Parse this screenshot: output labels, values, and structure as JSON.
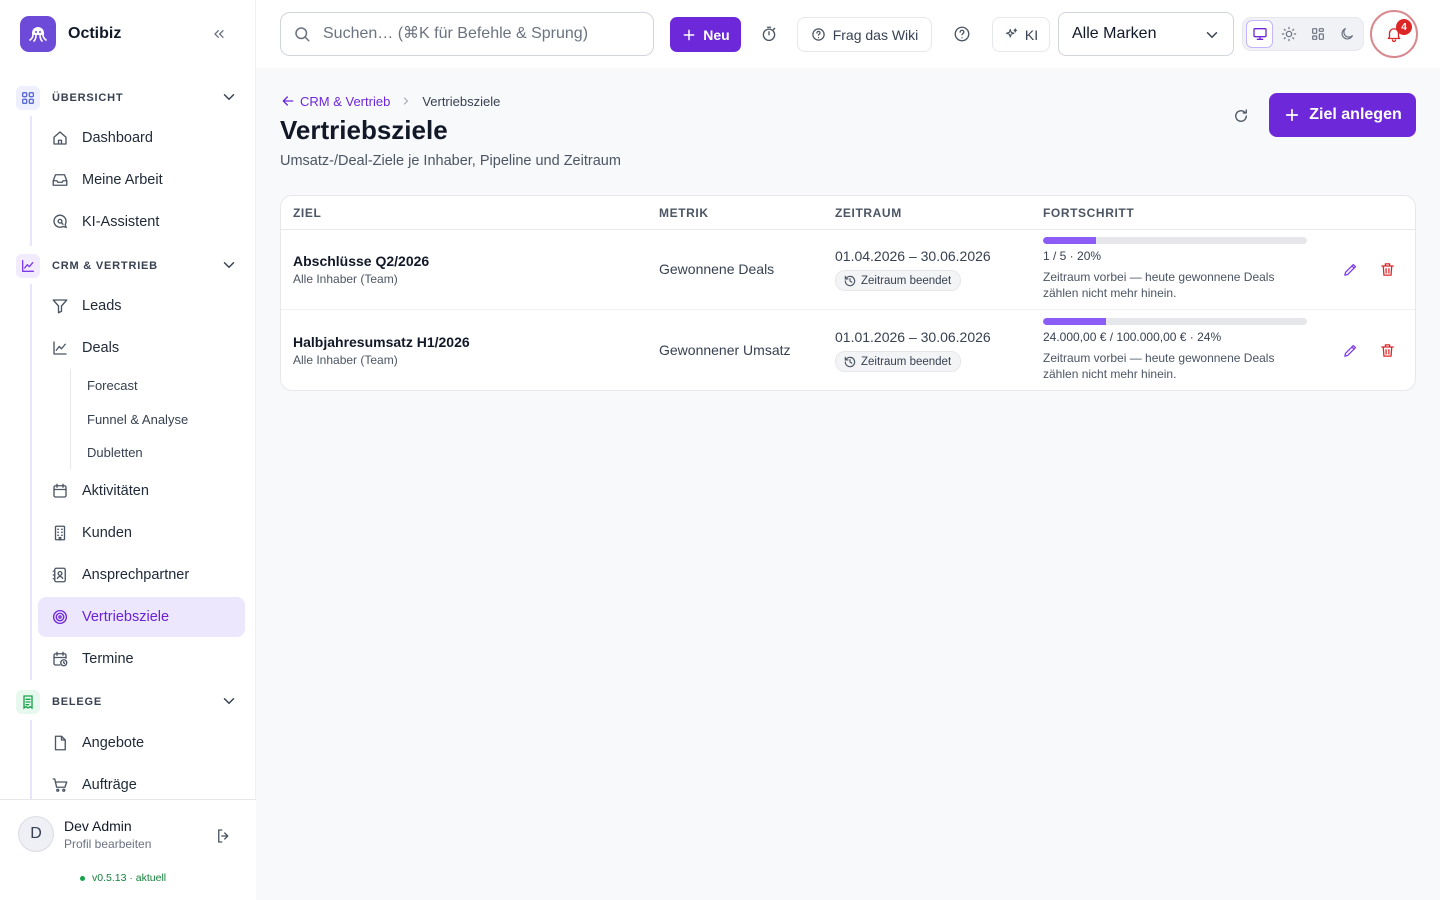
{
  "app": {
    "name": "Octibiz"
  },
  "sidebar": {
    "sections": [
      {
        "label": "ÜBERSICHT",
        "icon": "grid-icon"
      },
      {
        "label": "CRM & VERTRIEB",
        "icon": "trending-chart-icon"
      },
      {
        "label": "BELEGE",
        "icon": "receipt-icon"
      }
    ],
    "overview_items": [
      {
        "label": "Dashboard",
        "icon": "home-icon"
      },
      {
        "label": "Meine Arbeit",
        "icon": "inbox-icon"
      },
      {
        "label": "KI-Assistent",
        "icon": "chat-search-icon"
      }
    ],
    "crm_items": [
      {
        "label": "Leads",
        "icon": "funnel-icon"
      },
      {
        "label": "Deals",
        "icon": "line-chart-icon"
      },
      {
        "label": "Aktivitäten",
        "icon": "calendar-icon"
      },
      {
        "label": "Kunden",
        "icon": "building-icon"
      },
      {
        "label": "Ansprechpartner",
        "icon": "contact-card-icon"
      },
      {
        "label": "Vertriebsziele",
        "icon": "target-icon",
        "active": true
      },
      {
        "label": "Termine",
        "icon": "calendar-clock-icon"
      }
    ],
    "deal_subitems": [
      "Forecast",
      "Funnel & Analyse",
      "Dubletten"
    ],
    "belege_items": [
      {
        "label": "Angebote",
        "icon": "file-icon"
      },
      {
        "label": "Aufträge",
        "icon": "cart-icon"
      }
    ]
  },
  "profile": {
    "initial": "D",
    "name": "Dev Admin",
    "subtitle": "Profil bearbeiten",
    "version": "v0.5.13 · aktuell"
  },
  "topbar": {
    "search_placeholder": "Suchen… (⌘K für Befehle & Sprung)",
    "new_label": "Neu",
    "wiki_label": "Frag das Wiki",
    "ai_label": "KI",
    "brand_select": "Alle Marken",
    "notification_count": "4"
  },
  "main": {
    "breadcrumb": {
      "parent": "CRM & Vertrieb",
      "current": "Vertriebsziele"
    },
    "title": "Vertriebsziele",
    "subtitle": "Umsatz-/Deal-Ziele je Inhaber, Pipeline und Zeitraum",
    "create_label": "Ziel anlegen",
    "table": {
      "headers": {
        "goal": "ZIEL",
        "metric": "METRIK",
        "period": "ZEITRAUM",
        "progress": "FORTSCHRITT"
      },
      "rows": [
        {
          "title": "Abschlüsse Q2/2026",
          "owner": "Alle Inhaber (Team)",
          "metric": "Gewonnene Deals",
          "period": "01.04.2026 – 30.06.2026",
          "badge": "Zeitraum beendet",
          "progress_percent": 20,
          "progress_text": "1 / 5 · 20%",
          "note": "Zeitraum vorbei — heute gewonnene Deals zählen nicht mehr hinein."
        },
        {
          "title": "Halbjahresumsatz H1/2026",
          "owner": "Alle Inhaber (Team)",
          "metric": "Gewonnener Umsatz",
          "period": "01.01.2026 – 30.06.2026",
          "badge": "Zeitraum beendet",
          "progress_percent": 24,
          "progress_text": "24.000,00 € / 100.000,00 € · 24%",
          "note": "Zeitraum vorbei — heute gewonnene Deals zählen nicht mehr hinein."
        }
      ]
    }
  },
  "colors": {
    "accent": "#6d28d9",
    "progress": "#8b5cf6",
    "active_bg": "#ede7fe",
    "danger": "#dc2626"
  }
}
